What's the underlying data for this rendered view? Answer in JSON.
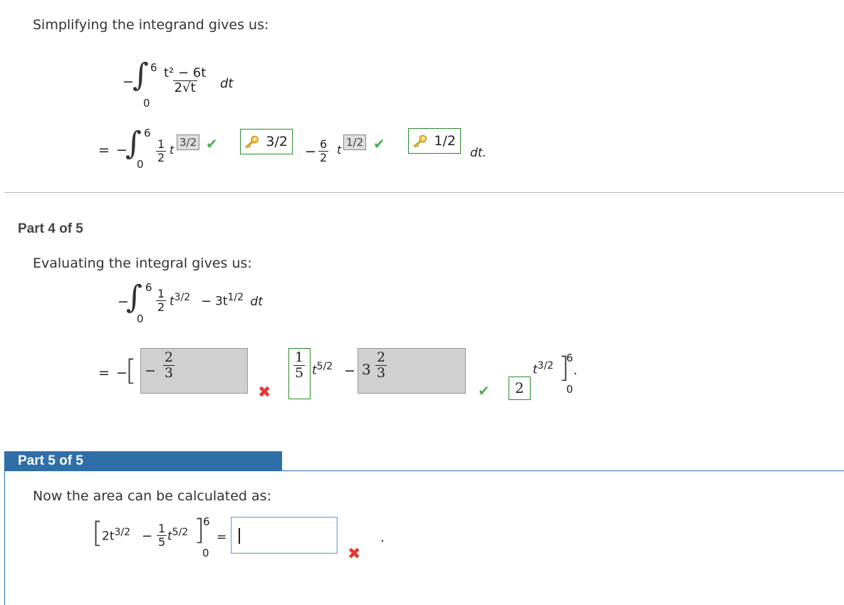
{
  "part3": {
    "intro": "Simplifying the integrand gives us:",
    "integral": {
      "upper": "6",
      "lower": "0",
      "numerator": "t² − 6t",
      "denominator": "2√t",
      "dt": "dt"
    },
    "result": {
      "equals": "=",
      "minus": "−",
      "upper": "6",
      "lower": "0",
      "coef1_num": "1",
      "coef1_den": "2",
      "var1": "t",
      "exp1_given": "3/2",
      "exp1_key": "3/2",
      "minus2": "−",
      "coef2_num": "6",
      "coef2_den": "2",
      "var2": "t",
      "exp2_given": "1/2",
      "exp2_key": "1/2",
      "dt": "dt."
    }
  },
  "part4": {
    "header": "Part 4 of 5",
    "intro": "Evaluating the integral gives us:",
    "integral": {
      "upper": "6",
      "lower": "0",
      "c1_num": "1",
      "c1_den": "2",
      "t1": "t",
      "e1": "3/2",
      "op": "−",
      "t2_coef": "3t",
      "e2": "1/2",
      "dt": "dt"
    },
    "result": {
      "equals": "=",
      "minus": "−",
      "frac_a_sign": "−",
      "frac_a_num": "2",
      "frac_a_den": "3",
      "frac_b_num": "1",
      "frac_b_den": "5",
      "t_b": "t",
      "e_b": "5/2",
      "op": "−",
      "whole_c": "3",
      "frac_c_num": "2",
      "frac_c_den": "3",
      "coef_d": "2",
      "t_d": "t",
      "e_d": "3/2",
      "upper": "6",
      "lower": "0",
      "period": "."
    }
  },
  "part5": {
    "header": "Part 5 of 5",
    "intro": "Now the area can be calculated as:",
    "expr": {
      "term1": "2t",
      "e1": "3/2",
      "op": "−",
      "c_num": "1",
      "c_den": "5",
      "t2": "t",
      "e2": "5/2",
      "upper": "6",
      "lower": "0",
      "equals": "="
    },
    "answer_value": "",
    "period": "."
  },
  "colors": {
    "part_bar": "#2f6ea9",
    "check": "#4caf50",
    "cross": "#e53935",
    "key_border": "#2b8a2b"
  }
}
